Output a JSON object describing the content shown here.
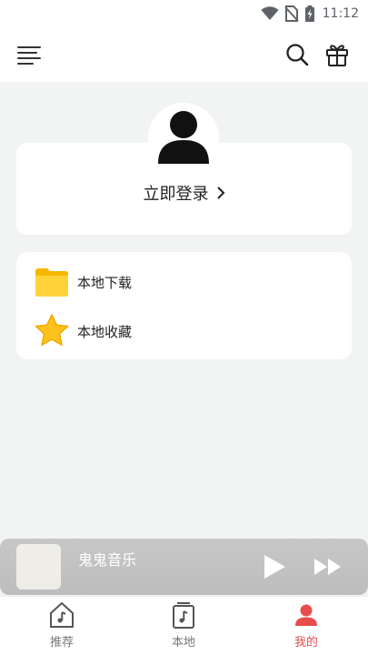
{
  "status_bar": {
    "time": "11:12"
  },
  "header": {
    "menu_icon": "menu-lines-icon",
    "search_icon": "search-icon",
    "gift_icon": "gift-icon"
  },
  "profile": {
    "login_label": "立即登录",
    "avatar_icon": "user-avatar-icon"
  },
  "menu": {
    "items": [
      {
        "label": "本地下载",
        "icon": "folder-icon"
      },
      {
        "label": "本地收藏",
        "icon": "star-icon"
      }
    ]
  },
  "player": {
    "title": "鬼鬼音乐",
    "state": "paused"
  },
  "bottom_nav": {
    "tabs": [
      {
        "label": "推荐",
        "icon": "home-music-icon",
        "active": false
      },
      {
        "label": "本地",
        "icon": "music-file-icon",
        "active": false
      },
      {
        "label": "我的",
        "icon": "person-icon",
        "active": true
      }
    ]
  },
  "colors": {
    "accent": "#e84d4d",
    "folder": "#ffcc2e",
    "star": "#f7b500"
  }
}
